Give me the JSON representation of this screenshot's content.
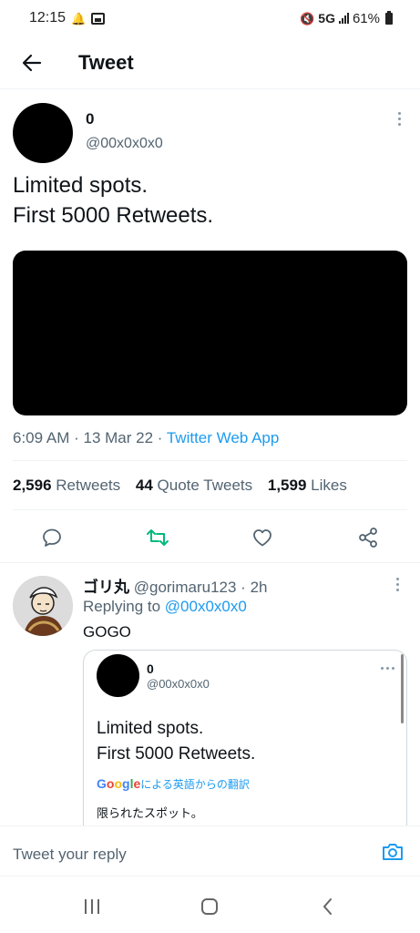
{
  "status_bar": {
    "time": "12:15",
    "network": "5G",
    "battery": "61%"
  },
  "header": {
    "title": "Tweet"
  },
  "tweet": {
    "author_name": "0",
    "author_handle": "@00x0x0x0",
    "text_line1": "Limited spots.",
    "text_line2": "First 5000 Retweets.",
    "time": "6:09 AM",
    "date": "13 Mar 22",
    "app": "Twitter Web App",
    "retweets_count": "2,596",
    "retweets_label": "Retweets",
    "quotes_count": "44",
    "quotes_label": "Quote Tweets",
    "likes_count": "1,599",
    "likes_label": "Likes"
  },
  "reply": {
    "name": "ゴリ丸",
    "handle": "@gorimaru123",
    "time": "2h",
    "replying_prefix": "Replying to",
    "replying_to": "@00x0x0x0",
    "text": "GOGO",
    "quote": {
      "name": "0",
      "handle": "@00x0x0x0",
      "line1": "Limited spots.",
      "line2": "First 5000 Retweets.",
      "translate_label": "による英語からの翻訳",
      "translated_text": "限られたスポット。"
    }
  },
  "compose": {
    "placeholder": "Tweet your reply"
  },
  "colors": {
    "accent_blue": "#1d9bf0",
    "retweet_green": "#00ba7c",
    "secondary_text": "#536471"
  }
}
